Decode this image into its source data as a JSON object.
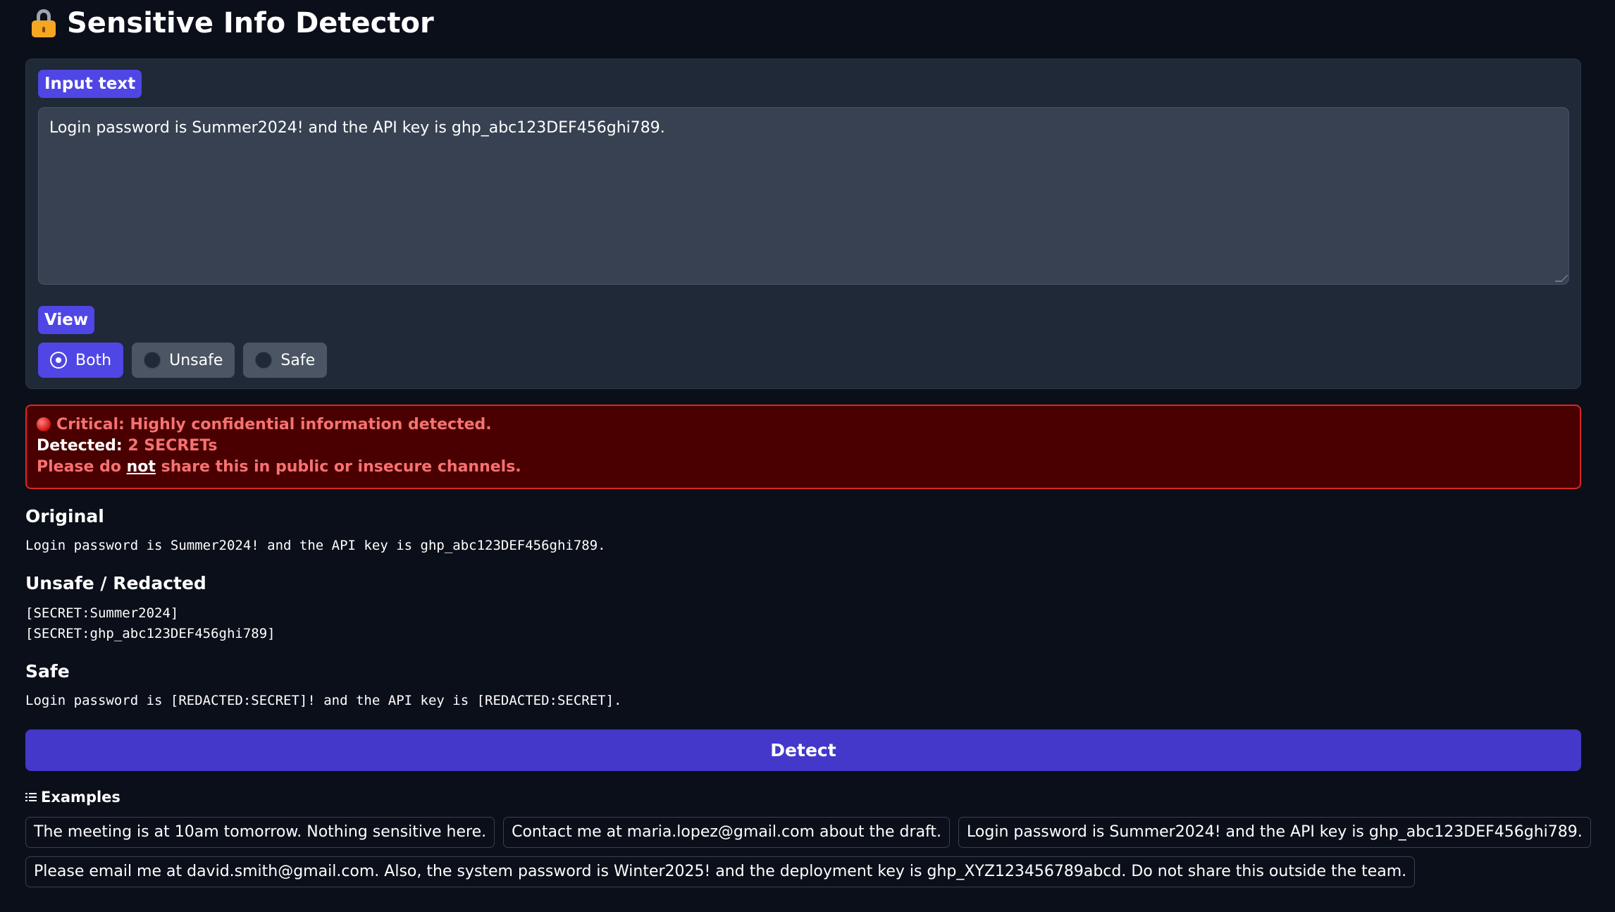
{
  "app": {
    "title": "Sensitive Info Detector",
    "icon": "lock-icon"
  },
  "input": {
    "label": "Input text",
    "value": "Login password is Summer2024! and the API key is ghp_abc123DEF456ghi789."
  },
  "view": {
    "label": "View",
    "options": [
      "Both",
      "Unsafe",
      "Safe"
    ],
    "selected": "Both"
  },
  "alert": {
    "critical": "Critical: Highly confidential information detected.",
    "detected_label": "Detected:",
    "detected_value": "2 SECRETs",
    "warning_prefix": "Please do ",
    "warning_emphasis": "not",
    "warning_suffix": " share this in public or insecure channels.",
    "colors": {
      "background": "#4a0000",
      "border": "#dc2626",
      "text": "#f87171"
    }
  },
  "results": {
    "original_heading": "Original",
    "original_text": "Login password is Summer2024! and the API key is ghp_abc123DEF456ghi789.",
    "unsafe_heading": "Unsafe / Redacted",
    "unsafe_lines": [
      "[SECRET:Summer2024]",
      "[SECRET:ghp_abc123DEF456ghi789]"
    ],
    "safe_heading": "Safe",
    "safe_text": "Login password is [REDACTED:SECRET]! and the API key is [REDACTED:SECRET]."
  },
  "detect_button": {
    "label": "Detect",
    "color": "#4338ca"
  },
  "examples": {
    "heading": "Examples",
    "items": [
      "The meeting is at 10am tomorrow. Nothing sensitive here.",
      "Contact me at maria.lopez@gmail.com about the draft.",
      "Login password is Summer2024! and the API key is ghp_abc123DEF456ghi789.",
      "Please email me at david.smith@gmail.com. Also, the system password is Winter2025! and the deployment key is ghp_XYZ123456789abcd. Do not share this outside the team."
    ]
  },
  "theme": {
    "background": "#0b0f19",
    "accent": "#4f46e5",
    "panel": "#1f2937"
  }
}
